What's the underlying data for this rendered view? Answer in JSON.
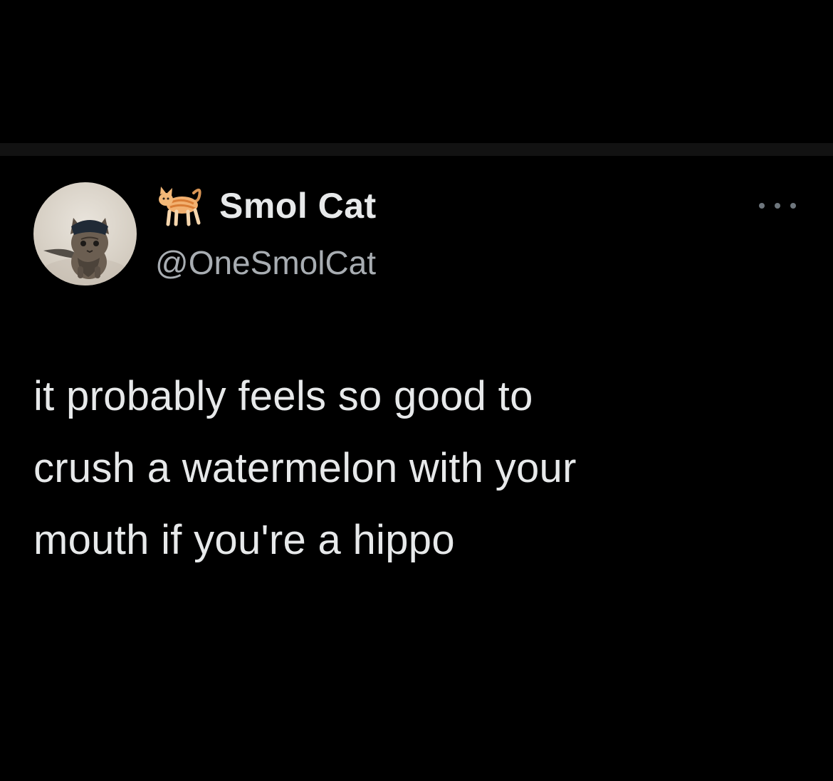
{
  "tweet": {
    "author": {
      "display_name": "Smol Cat",
      "handle": "@OneSmolCat",
      "name_emoji": "cat-emoji-icon",
      "avatar": "kitten-avatar"
    },
    "text": "it probably feels so good to\ncrush a watermelon with your\nmouth if you're a hippo",
    "more_menu_icon": "more-options-icon"
  },
  "colors": {
    "background": "#000000",
    "divider": "#121212",
    "primary_text": "#e7e9ea",
    "secondary_text": "#a8adb2",
    "icon_gray": "#6e767d"
  }
}
